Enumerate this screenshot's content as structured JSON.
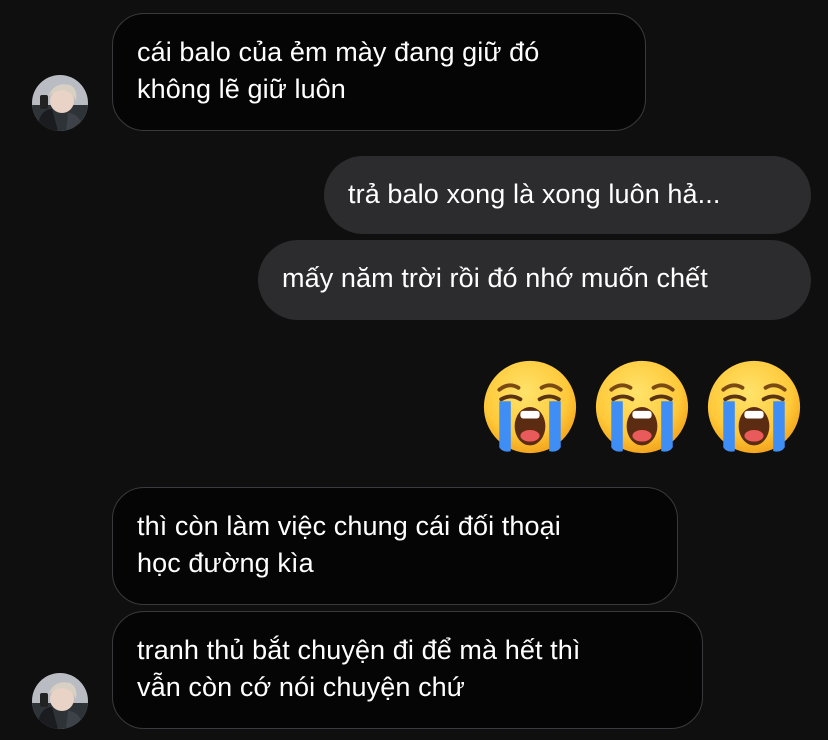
{
  "messages": [
    {
      "direction": "received",
      "text": "cái balo của ẻm mày đang giữ đó\nkhông lẽ giữ luôn"
    },
    {
      "direction": "sent",
      "text": "trả balo xong là xong luôn hả..."
    },
    {
      "direction": "sent",
      "text": "mấy năm trời rồi đó nhớ muốn chết"
    },
    {
      "direction": "sent",
      "emoji": [
        "loudly-crying-face",
        "loudly-crying-face",
        "loudly-crying-face"
      ]
    },
    {
      "direction": "received",
      "text": "thì còn làm việc chung cái đối thoại\nhọc đường kìa"
    },
    {
      "direction": "received",
      "text": "tranh thủ bắt chuyện đi để mà hết thì\nvẫn còn cớ nói chuyện chứ"
    }
  ],
  "colors": {
    "background": "#0f0f10",
    "received_bubble": "#050506",
    "received_border": "#3a3a3e",
    "sent_bubble": "#2c2c2e",
    "text": "#ffffff"
  },
  "icons": {
    "avatar": "contact-avatar",
    "emoji": "loudly-crying-face"
  }
}
